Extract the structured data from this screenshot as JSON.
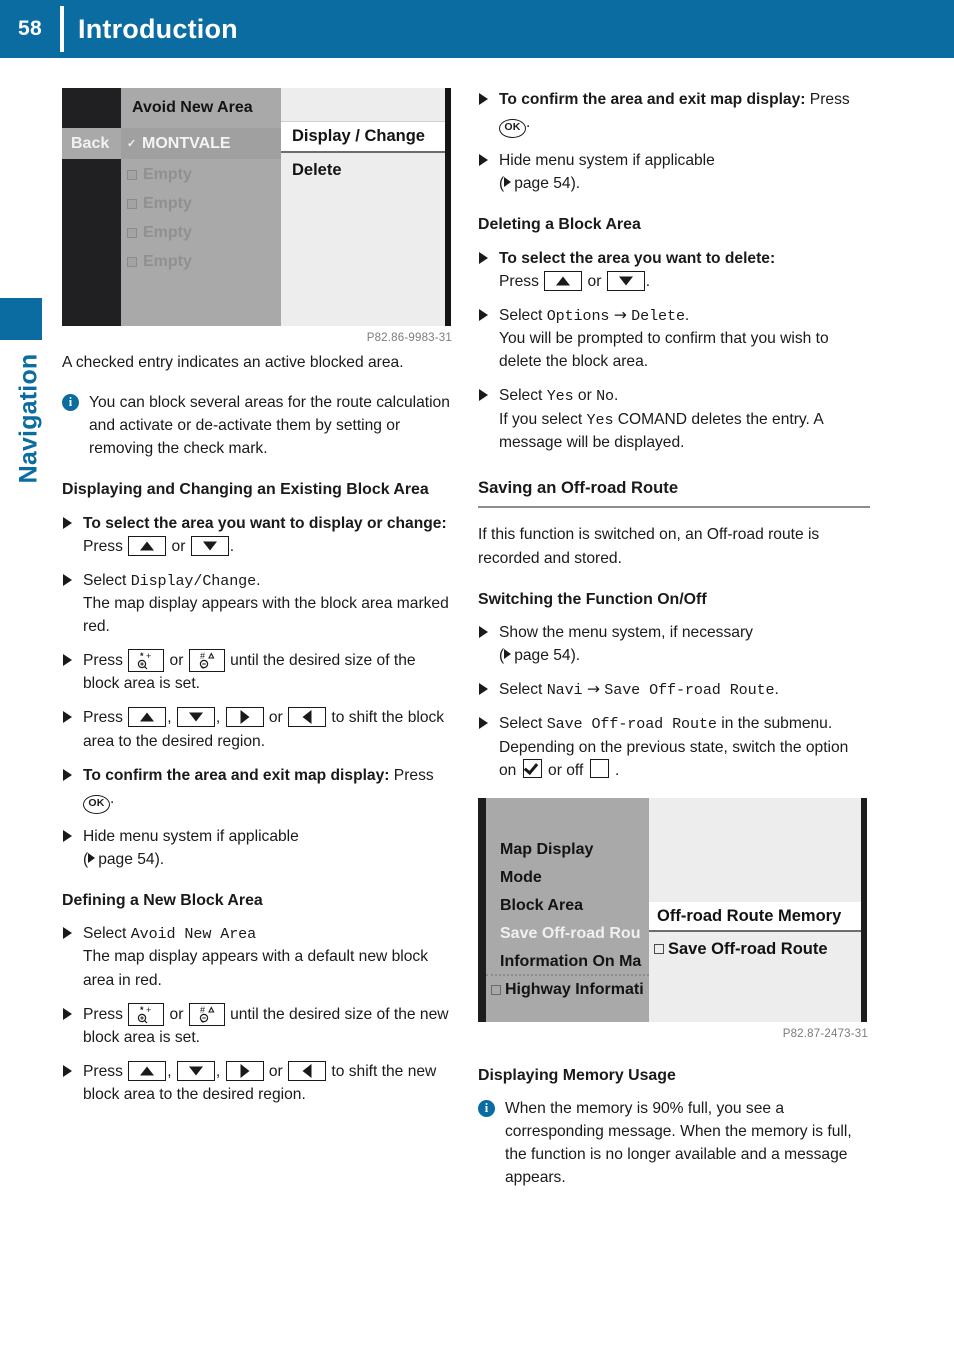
{
  "header": {
    "page_number": "58",
    "title": "Introduction"
  },
  "side_tab": {
    "label": "Navigation"
  },
  "colors": {
    "brand_blue": "#0a6ca0",
    "rule_gray": "#8d8d8d",
    "caption_gray": "#7c7c7c"
  },
  "figure1": {
    "caption": "P82.86-9983-31",
    "back_label": "Back",
    "list_header": "Avoid New Area",
    "list_rows": [
      {
        "label": "MONTVALE",
        "checked": true,
        "selected": true
      },
      {
        "label": "Empty",
        "checked": false,
        "selected": false
      },
      {
        "label": "Empty",
        "checked": false,
        "selected": false
      },
      {
        "label": "Empty",
        "checked": false,
        "selected": false
      },
      {
        "label": "Empty",
        "checked": false,
        "selected": false
      }
    ],
    "panel_selected": "Display / Change",
    "panel_item": "Delete"
  },
  "figure2": {
    "caption": "P82.87-2473-31",
    "menu_rows": [
      {
        "label": "Map Display",
        "checkbox": false,
        "selected": false
      },
      {
        "label": "Mode",
        "checkbox": false,
        "selected": false
      },
      {
        "label": "Block Area",
        "checkbox": false,
        "selected": false
      },
      {
        "label": "Save Off-road Rou",
        "checkbox": false,
        "selected": true
      },
      {
        "label": "Information On Ma",
        "checkbox": false,
        "selected": false
      },
      {
        "label": "Highway Informati",
        "checkbox": true,
        "selected": false
      }
    ],
    "panel_title": "Off-road Route Memory",
    "panel_item": "Save Off-road Route"
  },
  "left_column": {
    "intro_paragraph": "A checked entry indicates an active blocked area.",
    "note": "You can block several areas for the route calculation and activate or de-activate them by setting or removing the check mark.",
    "heading_display_change": "Displaying and Changing an Existing Block Area",
    "steps_display_change": [
      {
        "bold_lead": "To select the area you want to display or change:",
        "rest_before": " Press ",
        "keys": [
          "up",
          "or",
          "down"
        ],
        "rest_after": "."
      },
      {
        "lead": "Select ",
        "mono": "Display/Change",
        "tail": ".",
        "detail": "The map display appears with the block area marked red."
      },
      {
        "lead": "Press ",
        "keys": [
          "zoom-in",
          "or",
          "zoom-out"
        ],
        "tail": " until the desired size of the block area is set."
      },
      {
        "lead": "Press ",
        "keys": [
          "up",
          "down",
          "right",
          "or",
          "left"
        ],
        "tail": " to shift the block area to the desired region."
      },
      {
        "bold_lead": "To confirm the area and exit map display:",
        "rest_before": " Press ",
        "keys": [
          "ok"
        ],
        "rest_after": "."
      },
      {
        "lead": "Hide menu system if applicable",
        "page_ref": "page 54",
        "tail": ")."
      }
    ],
    "heading_defining": "Defining a New Block Area",
    "steps_defining": [
      {
        "lead": "Select ",
        "mono": "Avoid New Area",
        "detail": "The map display appears with a default new block area in red."
      },
      {
        "lead": "Press ",
        "keys": [
          "zoom-in",
          "or",
          "zoom-out"
        ],
        "tail": " until the desired size of the new block area is set."
      },
      {
        "lead": "Press ",
        "keys": [
          "up",
          "down",
          "right",
          "or",
          "left"
        ],
        "tail": " to shift the new block area to the desired region."
      }
    ]
  },
  "right_column": {
    "steps_top": [
      {
        "bold_lead": "To confirm the area and exit map display:",
        "rest_before": " Press ",
        "keys": [
          "ok"
        ],
        "rest_after": "."
      },
      {
        "lead": "Hide menu system if applicable",
        "page_ref": "page 54",
        "tail": ")."
      }
    ],
    "heading_deleting": "Deleting a Block Area",
    "steps_deleting": [
      {
        "bold_lead": "To select the area you want to delete:",
        "rest_before": " Press ",
        "keys": [
          "up",
          "or",
          "down"
        ],
        "rest_after": "."
      },
      {
        "lead": "Select ",
        "mono1": "Options",
        "arrow": "→",
        "mono2": "Delete",
        "tail": ".",
        "detail": "You will be prompted to confirm that you wish to delete the block area."
      },
      {
        "lead": "Select ",
        "mono1": "Yes",
        "mid": " or ",
        "mono2": "No",
        "tail": ".",
        "detail_pre": "If you select ",
        "detail_mono": "Yes",
        "detail_post": " COMAND deletes the entry. A message will be displayed."
      }
    ],
    "section_saving": "Saving an Off-road Route",
    "saving_paragraph": "If this function is switched on, an Off-road route is recorded and stored.",
    "heading_switching": "Switching the Function On/Off",
    "steps_switching": [
      {
        "lead": "Show the menu system, if necessary",
        "page_ref": "page 54",
        "tail": ")."
      },
      {
        "lead": "Select ",
        "mono1": "Navi",
        "arrow": "→",
        "mono2": "Save Off-road Route",
        "tail": "."
      },
      {
        "lead": "Select ",
        "mono1": "Save Off-road Route",
        "tail": " in the submenu.",
        "detail_pre": "Depending on the previous state, switch the option on ",
        "detail_mid": " or off ",
        "detail_post": " ."
      }
    ],
    "heading_memory": "Displaying Memory Usage",
    "note_memory": "When the memory is 90% full, you see a corresponding message. When the memory is full, the function is no longer available and a message appears."
  }
}
